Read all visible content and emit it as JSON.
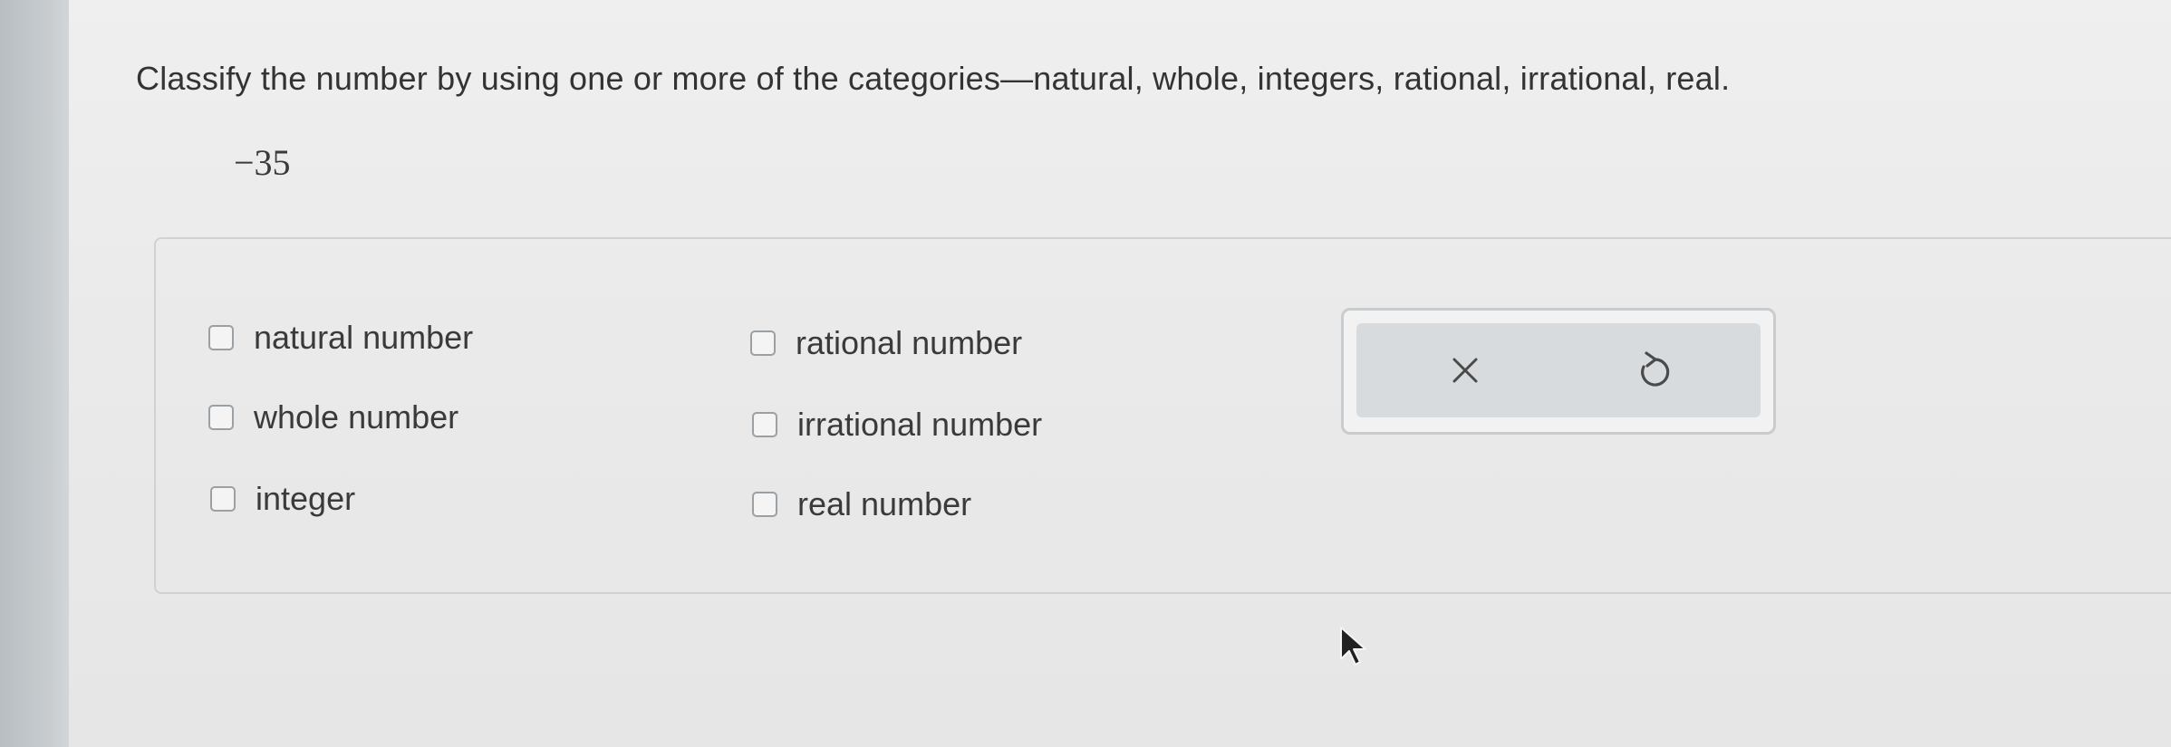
{
  "question": {
    "prompt": "Classify the number by using one or more of the categories—natural, whole, integers, rational, irrational, real.",
    "number": "−35"
  },
  "options": {
    "col1": [
      "natural number",
      "whole number",
      "integer"
    ],
    "col2": [
      "rational number",
      "irrational number",
      "real number"
    ],
    "checked": []
  },
  "actions": {
    "clear_icon": "x-icon",
    "undo_icon": "undo-icon"
  },
  "colors": {
    "background": "#eaeaea",
    "text": "#333333",
    "border": "#cfd2d4",
    "action_bg": "#d8dbdd"
  }
}
